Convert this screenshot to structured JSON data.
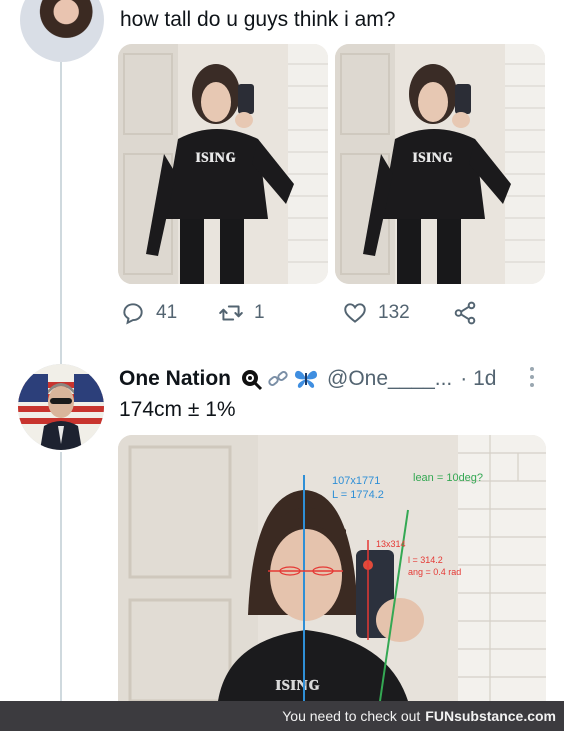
{
  "tweet1": {
    "text": "how tall do u guys think i am?",
    "stats": {
      "replies": "41",
      "retweets": "1",
      "likes": "132"
    }
  },
  "tweet2": {
    "display_name": "One Nation",
    "handle": "@One____...",
    "time": "· 1d",
    "text": "174cm ± 1%",
    "annotations": {
      "dims_top": "107x1771",
      "length_top": "L = 1774.2",
      "lean": "lean = 10deg?",
      "dims_small": "13x314",
      "length_small": "l = 314.2",
      "angle": "ang = 0.4 rad"
    }
  },
  "footer": {
    "prefix": "You need to check out",
    "brand": "FUNsubstance.com"
  },
  "colors": {
    "text": "#0f1419",
    "muted": "#536471",
    "footer_bg": "#3c3b3f",
    "annotation_blue": "#2f8fd6",
    "annotation_green": "#34a853",
    "annotation_red": "#e53935"
  }
}
